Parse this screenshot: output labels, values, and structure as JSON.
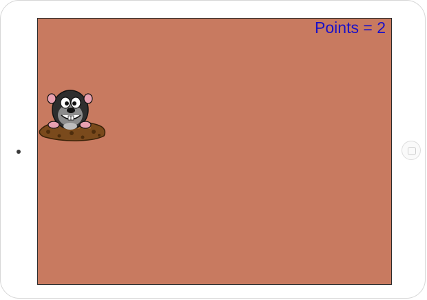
{
  "game": {
    "score_label": "Points",
    "score_separator": "=",
    "score_value": "2"
  },
  "colors": {
    "field": "#c87a60",
    "score_text": "#1a10c8",
    "bezel": "#ffffff"
  },
  "sprites": {
    "mole": "mole-in-hole"
  }
}
